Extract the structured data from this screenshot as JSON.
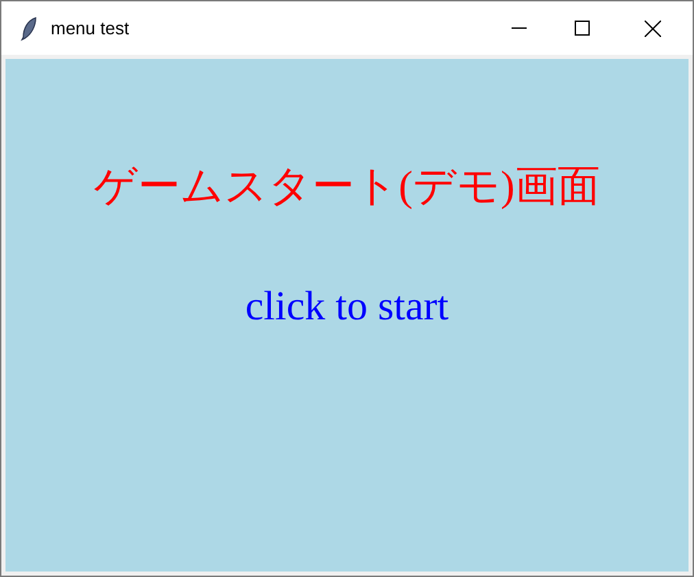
{
  "window": {
    "title": "menu test"
  },
  "canvas": {
    "heading": "ゲームスタート(デモ)画面",
    "prompt": "click to start"
  }
}
